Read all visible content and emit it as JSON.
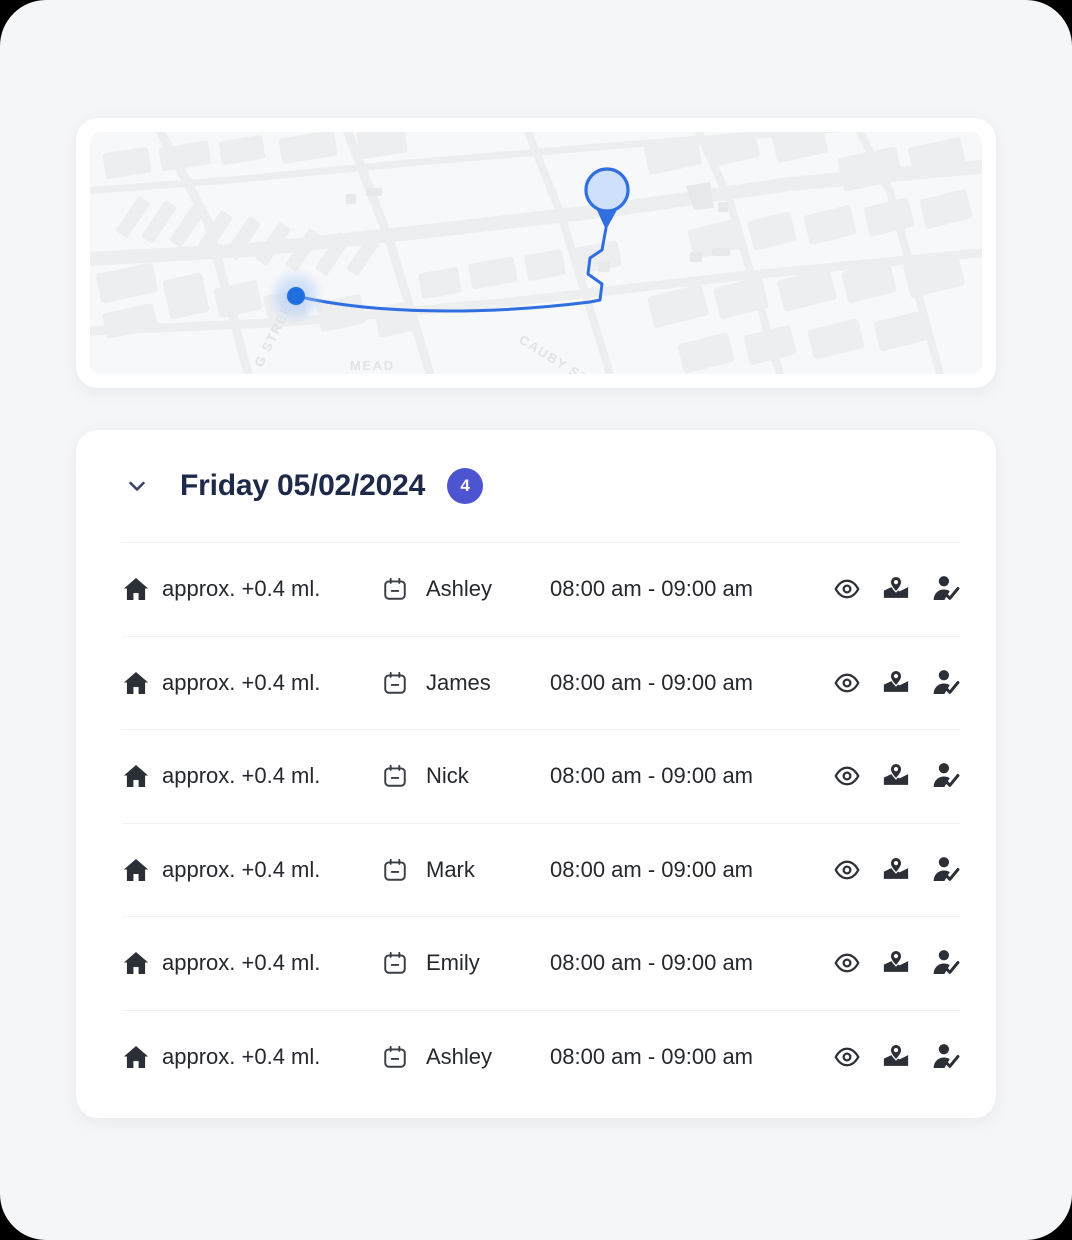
{
  "theme": {
    "page_bg": "#f5f6f8",
    "card_bg": "#ffffff",
    "accent_badge": "#4c54d2",
    "title_color": "#1f2a4a",
    "text_color": "#25282e",
    "route_color": "#2f6fe0",
    "origin_dot": "#1f6fe0",
    "pin_fill": "#cfe0fb",
    "pin_stroke": "#2f6fe0",
    "divider": "#f0f1f3",
    "map_bg": "#f7f8f9",
    "map_block": "#eceef0"
  },
  "map": {
    "name": "route-map",
    "street_labels": [
      "G STREET",
      "MEAD",
      "CAUBY ST"
    ],
    "origin_marker": "origin-dot",
    "destination_marker": "destination-pin"
  },
  "list": {
    "header": {
      "chevron": "chevron-down-icon",
      "title": "Friday 05/02/2024",
      "count": "4"
    },
    "rows": [
      {
        "distance": "approx. +0.4 ml.",
        "name": "Ashley",
        "time": "08:00 am - 09:00 am"
      },
      {
        "distance": "approx. +0.4 ml.",
        "name": "James",
        "time": "08:00 am - 09:00 am"
      },
      {
        "distance": "approx. +0.4 ml.",
        "name": "Nick",
        "time": "08:00 am - 09:00 am"
      },
      {
        "distance": "approx. +0.4 ml.",
        "name": "Mark",
        "time": "08:00 am - 09:00 am"
      },
      {
        "distance": "approx. +0.4 ml.",
        "name": "Emily",
        "time": "08:00 am - 09:00 am"
      },
      {
        "distance": "approx. +0.4 ml.",
        "name": "Ashley",
        "time": "08:00 am - 09:00 am"
      }
    ],
    "row_icons": {
      "home": "home-icon",
      "calendar": "calendar-icon",
      "view": "eye-icon",
      "map": "map-pin-icon",
      "assign": "person-check-icon"
    }
  }
}
